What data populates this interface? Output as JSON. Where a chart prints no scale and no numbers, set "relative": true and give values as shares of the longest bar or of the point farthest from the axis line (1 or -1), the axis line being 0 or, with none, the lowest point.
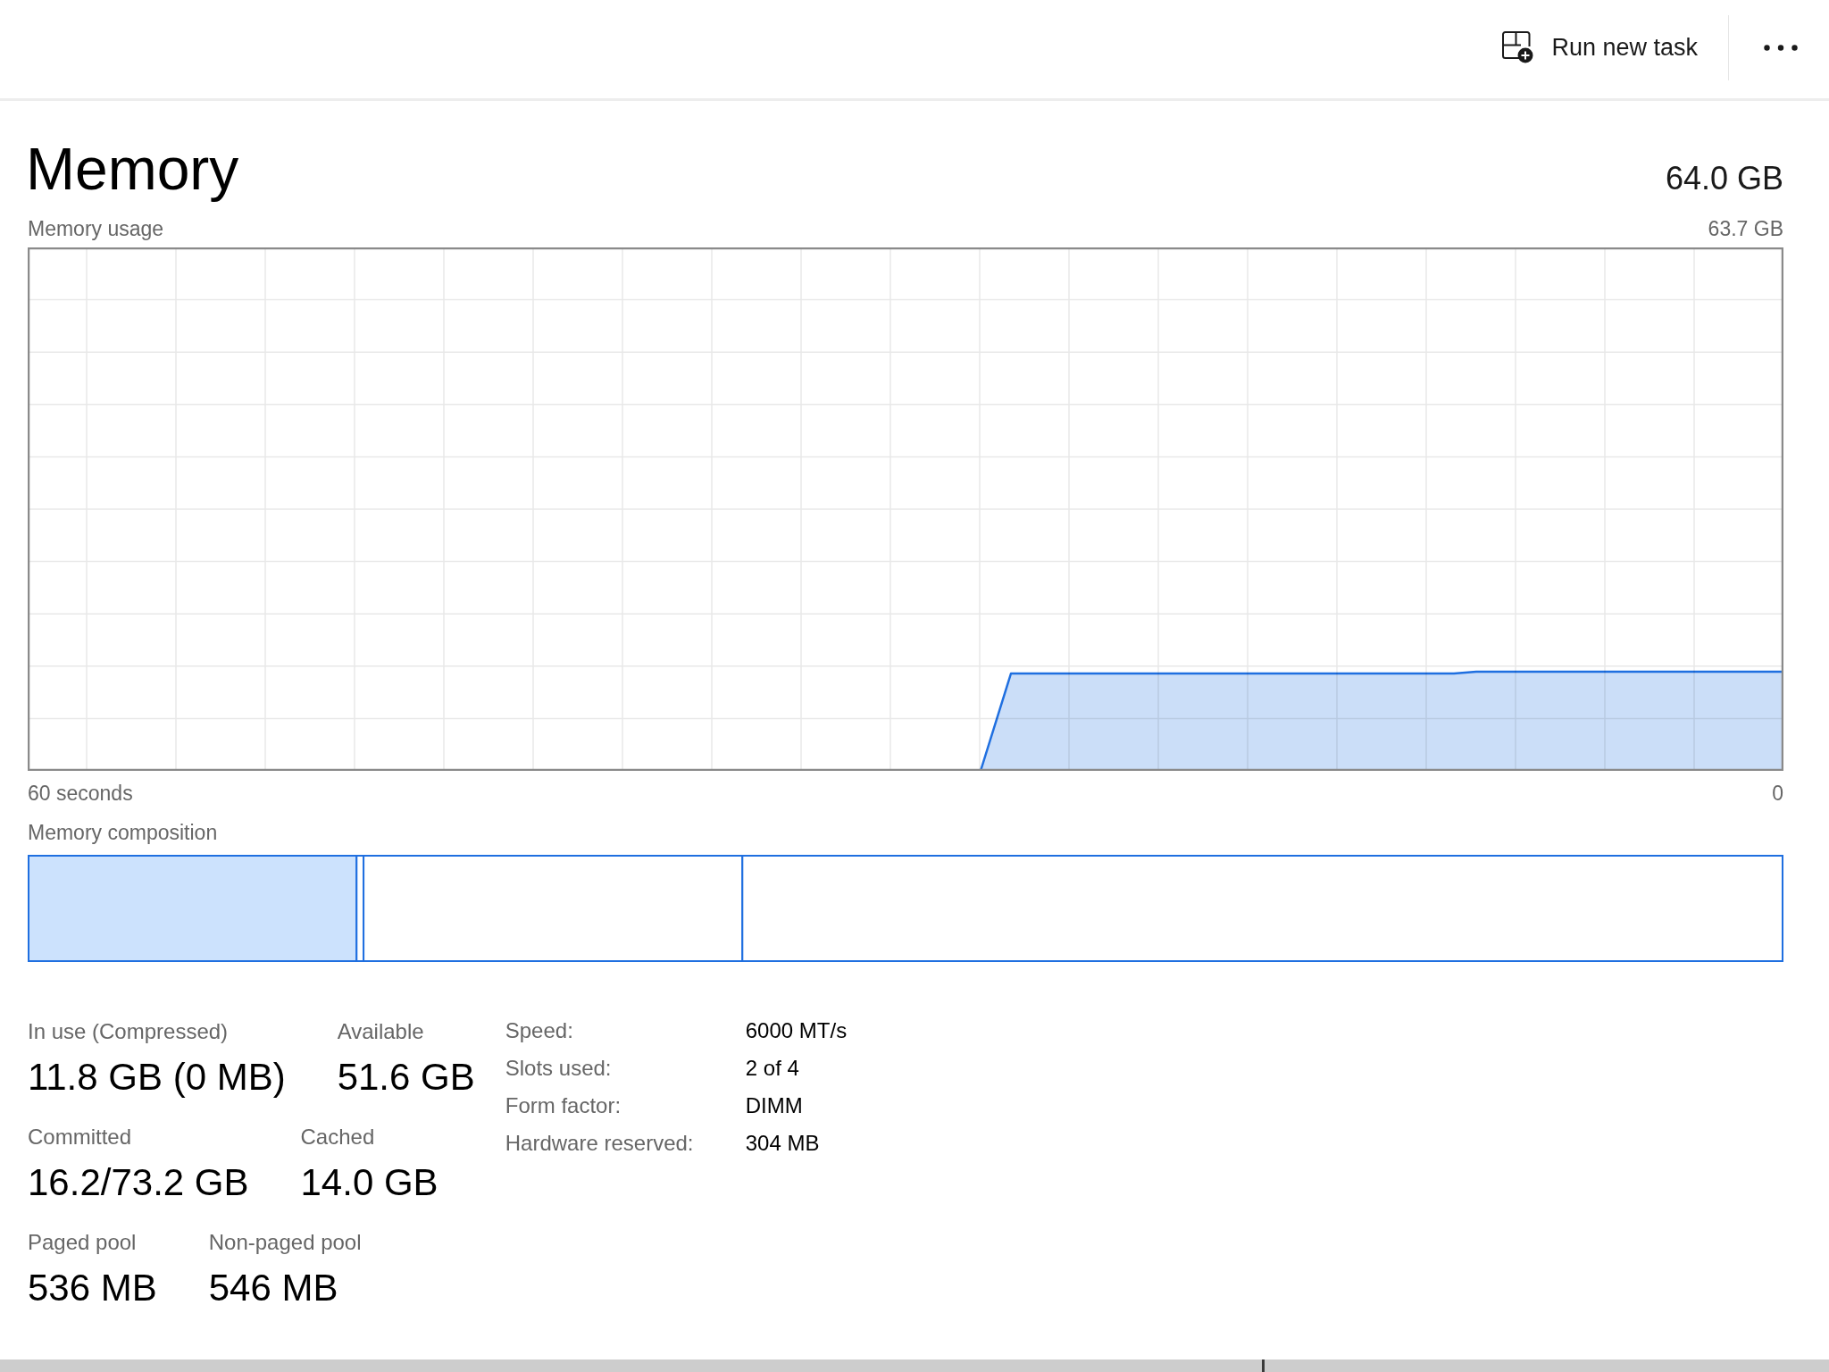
{
  "toolbar": [
    {
      "kind": "command",
      "label": "Run new task"
    },
    {
      "kind": "overflow"
    }
  ],
  "header": {
    "title": "Memory",
    "total": "64.0 GB"
  },
  "usage_graph": {
    "title": "Memory usage",
    "max_label": "63.7 GB",
    "start_label": "60 seconds",
    "end_label": "0"
  },
  "composition": {
    "chart_data": {
      "type": "bar",
      "title": "Memory composition",
      "orientation": "horizontal",
      "stacked": true,
      "relative": true,
      "categories": [
        null
      ],
      "series": [
        {
          "color": "#cce2fd",
          "values": [
            0.187
          ]
        },
        {
          "color": "#ffffff",
          "values": [
            0.004
          ]
        },
        {
          "color": "#ffffff",
          "values": [
            0.216
          ]
        },
        {
          "color": "#ffffff",
          "values": [
            0.593
          ]
        }
      ]
    }
  },
  "stats": [
    [
      {
        "label": "In use (Compressed)",
        "value": "11.8 GB (0 MB)"
      },
      {
        "label": "Available",
        "value": "51.6 GB"
      }
    ],
    [
      {
        "label": "Committed",
        "value": "16.2/73.2 GB"
      },
      {
        "label": "Cached",
        "value": "14.0 GB"
      }
    ],
    [
      {
        "label": "Paged pool",
        "value": "536 MB"
      },
      {
        "label": "Non-paged pool",
        "value": "546 MB"
      }
    ]
  ],
  "details": [
    {
      "label": "Speed:",
      "value": "6000 MT/s"
    },
    {
      "label": "Slots used:",
      "value": "2 of 4"
    },
    {
      "label": "Form factor:",
      "value": "DIMM"
    },
    {
      "label": "Hardware reserved:",
      "value": "304 MB"
    }
  ]
}
